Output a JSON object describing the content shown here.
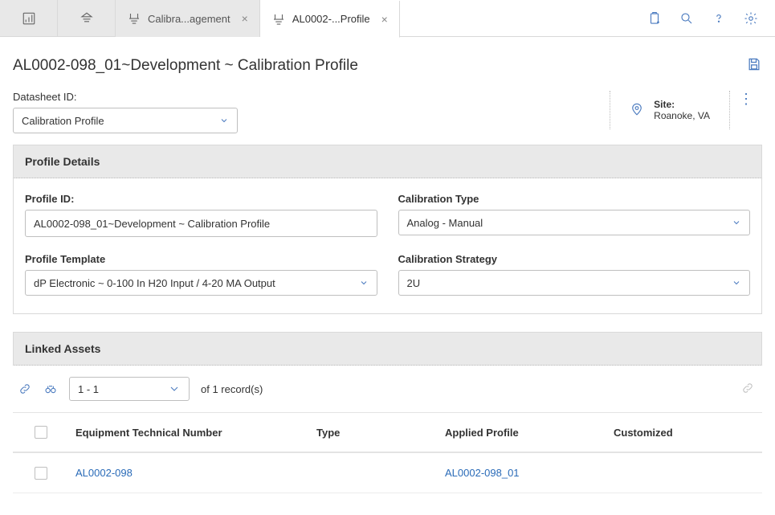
{
  "tabs": {
    "tab1_label": "Calibra...agement",
    "tab2_label": "AL0002-...Profile"
  },
  "page_title": "AL0002-098_01~Development ~ Calibration Profile",
  "datasheet": {
    "label": "Datasheet ID:",
    "value": "Calibration Profile"
  },
  "site": {
    "label": "Site:",
    "value": "Roanoke, VA"
  },
  "profile_details": {
    "header": "Profile Details",
    "profile_id": {
      "label": "Profile ID:",
      "value": "AL0002-098_01~Development ~ Calibration Profile"
    },
    "calibration_type": {
      "label": "Calibration Type",
      "value": "Analog - Manual"
    },
    "profile_template": {
      "label": "Profile Template",
      "value": "dP Electronic ~ 0-100 In H20 Input / 4-20 MA Output"
    },
    "calibration_strategy": {
      "label": "Calibration Strategy",
      "value": "2U"
    }
  },
  "linked_assets": {
    "header": "Linked Assets",
    "pager_value": "1 - 1",
    "pager_suffix": "of 1 record(s)",
    "columns": {
      "etn": "Equipment Technical Number",
      "type": "Type",
      "applied_profile": "Applied Profile",
      "customized": "Customized"
    },
    "rows": [
      {
        "etn": "AL0002-098",
        "type": "",
        "applied_profile": "AL0002-098_01",
        "customized": ""
      }
    ]
  }
}
